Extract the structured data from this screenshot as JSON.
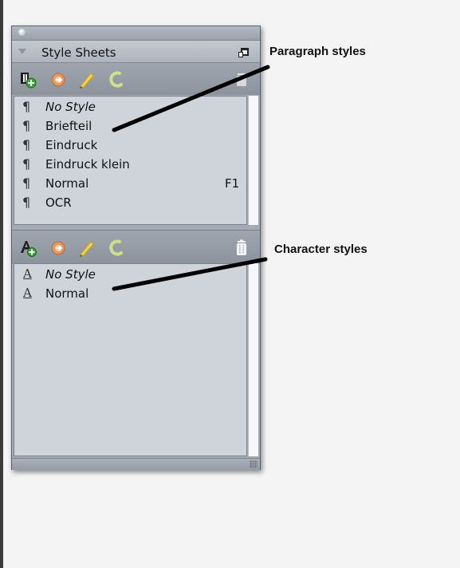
{
  "palette": {
    "title": "Style Sheets",
    "paragraph_styles": [
      {
        "label": "No Style",
        "italic": true,
        "key": ""
      },
      {
        "label": "Briefteil",
        "italic": false,
        "key": ""
      },
      {
        "label": "Eindruck",
        "italic": false,
        "key": ""
      },
      {
        "label": "Eindruck klein",
        "italic": false,
        "key": ""
      },
      {
        "label": "Normal",
        "italic": false,
        "key": "F1"
      },
      {
        "label": "OCR",
        "italic": false,
        "key": ""
      }
    ],
    "character_styles": [
      {
        "label": "No Style",
        "italic": true
      },
      {
        "label": "Normal",
        "italic": false
      }
    ],
    "icons": {
      "paragraph_glyph": "¶",
      "character_glyph": "A"
    }
  },
  "annotations": {
    "paragraph_label": "Paragraph styles",
    "character_label": "Character styles"
  },
  "colors": {
    "panel": "#a4abb5",
    "list_bg": "#cfd4db",
    "accent_yellow": "#f4d64a",
    "accent_green": "#cfe08a"
  }
}
